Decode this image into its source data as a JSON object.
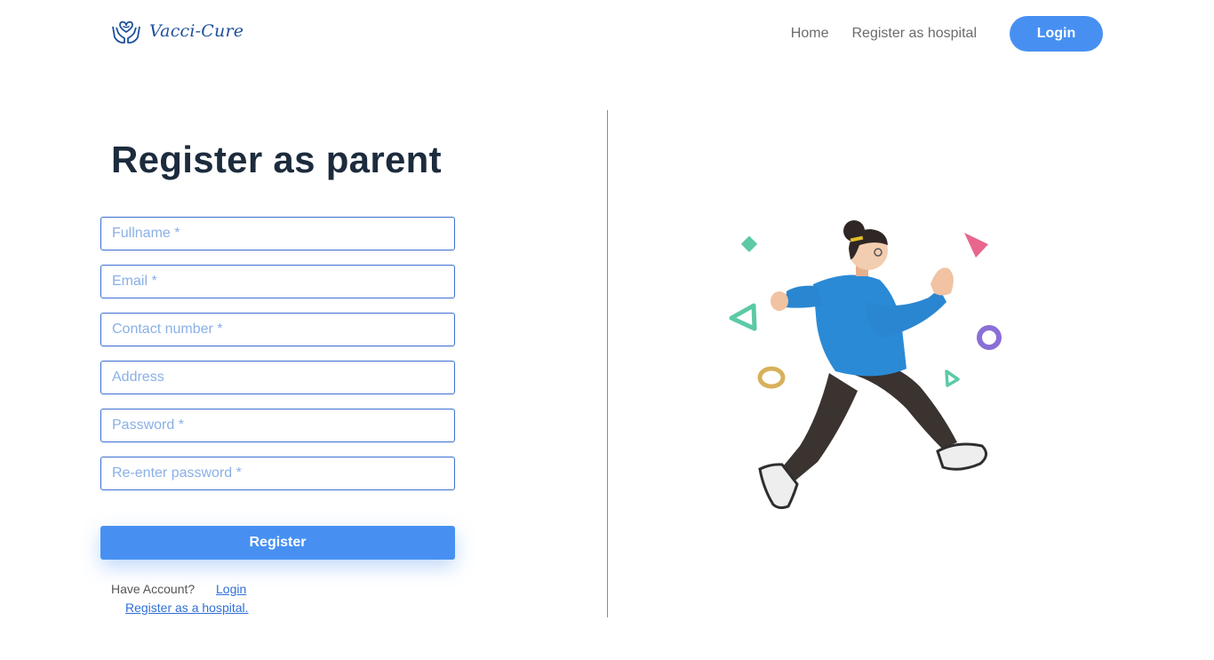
{
  "header": {
    "brand": "Vacci-Cure",
    "logo_icon": "hands-heart-icon",
    "nav": {
      "home": "Home",
      "register_hospital": "Register as hospital",
      "login": "Login"
    }
  },
  "form": {
    "title": "Register as parent",
    "fields": {
      "fullname": {
        "value": "",
        "placeholder": "Fullname *"
      },
      "email": {
        "value": "",
        "placeholder": "Email *"
      },
      "contact": {
        "value": "",
        "placeholder": "Contact number *"
      },
      "address": {
        "value": "",
        "placeholder": "Address"
      },
      "password": {
        "value": "",
        "placeholder": "Password *"
      },
      "repassword": {
        "value": "",
        "placeholder": "Re-enter password *"
      }
    },
    "submit_label": "Register",
    "have_account": "Have Account?",
    "login_link": "Login",
    "hospital_link": "Register as a hospital."
  },
  "colors": {
    "accent": "#4790f2",
    "brand_text": "#1d4f9c",
    "title": "#1c2b3d",
    "field_border": "#3a6fd0",
    "placeholder": "#8ab0e6",
    "divider": "#5f9bb0"
  },
  "illustration": {
    "icon": "running-person-illustration"
  }
}
